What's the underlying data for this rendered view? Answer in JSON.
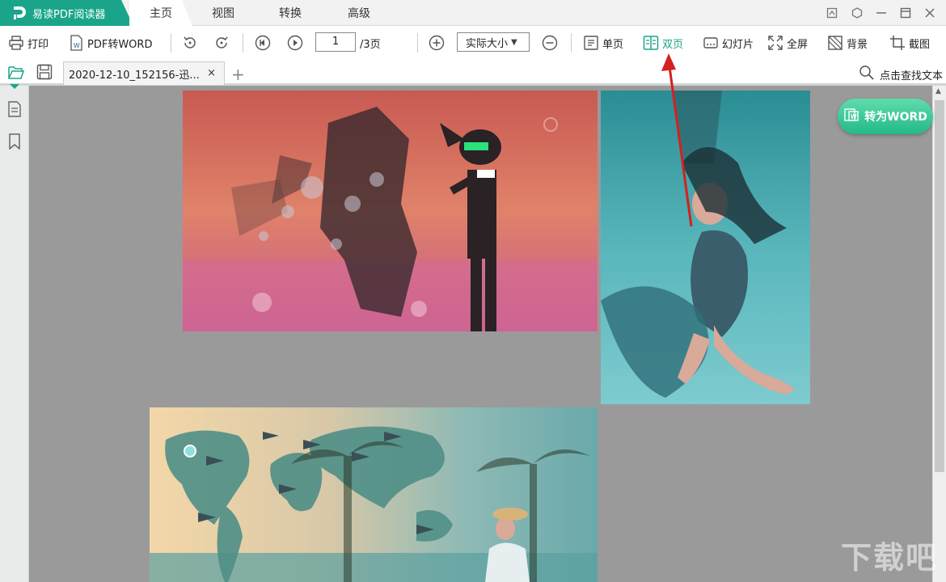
{
  "app": {
    "title": "易读PDF阅读器"
  },
  "menu": {
    "tabs": [
      "主页",
      "视图",
      "转换",
      "高级"
    ],
    "active": "主页"
  },
  "window": {
    "icons": [
      "skin-icon",
      "settings-icon",
      "minimize-icon",
      "maximize-icon",
      "close-icon"
    ]
  },
  "toolbar": {
    "print": "打印",
    "pdf_to_word": "PDF转WORD",
    "page_current": "1",
    "page_total": "/3页",
    "zoom": "实际大小",
    "single_page": "单页",
    "double_page": "双页",
    "slideshow": "幻灯片",
    "fullscreen": "全屏",
    "background": "背景",
    "screenshot": "截图"
  },
  "tabs": {
    "document": "2020-12-10_152156-迅...",
    "close": "×",
    "add": "+",
    "search": "点击查找文本"
  },
  "content": {
    "word_button": "转为WORD",
    "watermark": "下载吧"
  },
  "colors": {
    "accent": "#1aa58a",
    "arrow": "#d42020",
    "canvas": "#9a9a9a"
  }
}
